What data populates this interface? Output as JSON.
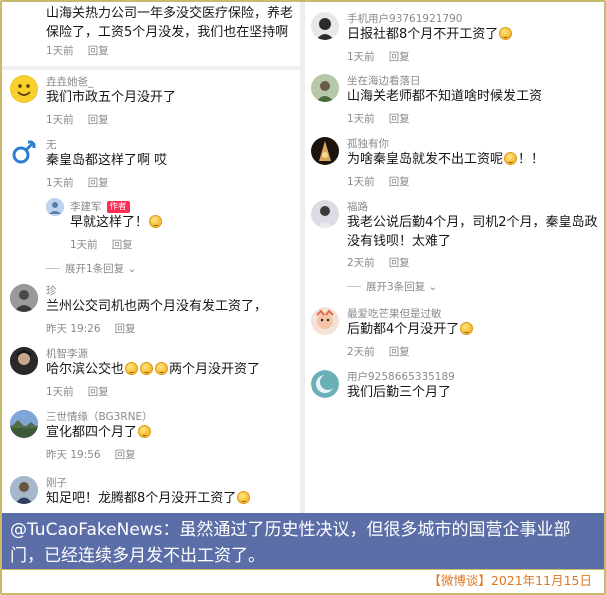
{
  "left_column": {
    "top_comment": {
      "text": "山海关热力公司一年多没交医疗保险，养老保险了，工资5个月没发，我们也在坚持啊",
      "time": "1天前",
      "reply": "回复"
    },
    "comments": [
      {
        "user": "垚垚她爸_",
        "text": "我们市政五个月没开了",
        "time": "1天前",
        "reply": "回复",
        "avatar": "smiley-face-icon",
        "avatar_color": "#f2c230"
      },
      {
        "user": "无",
        "text": "秦皇岛都这样了啊 哎",
        "time": "1天前",
        "reply": "回复",
        "avatar": "male-symbol-icon",
        "avatar_color": "#2a7fd4"
      },
      {
        "user": "珍",
        "text": "兰州公交司机也两个月没有发工资了，",
        "time": "昨天 19:26",
        "reply": "回复",
        "avatar": "person-photo-icon",
        "avatar_color": "#6b6b6b"
      },
      {
        "user": "机智李源",
        "text_before": "哈尔滨公交也",
        "text_after": "两个月没开资了",
        "time": "1天前",
        "reply": "回复",
        "avatar": "person-photo-icon",
        "avatar_color": "#303030"
      },
      {
        "user": "三世情缘（BG3RNE）",
        "text": "宣化都四个月了",
        "time": "昨天 19:56",
        "reply": "回复",
        "avatar": "landscape-photo-icon",
        "avatar_color": "#4a6a9a"
      },
      {
        "user": "刚子",
        "text": "知足吧！龙腾都8个月没开工资了",
        "time": "",
        "reply": "",
        "avatar": "person-photo-icon",
        "avatar_color": "#7a8aa0"
      }
    ],
    "sub_reply": {
      "user": "李建军",
      "author_tag": "作者",
      "text": "早就这样了！",
      "time": "1天前",
      "reply": "回复"
    },
    "expand_label": "展开1条回复"
  },
  "right_column": {
    "comments": [
      {
        "user": "手机用户93761921790",
        "text": "日报社都8个月不开工资了",
        "time": "1天前",
        "reply": "回复",
        "avatar_color": "#2b2b2b"
      },
      {
        "user": "坐在海边看落日",
        "text": "山海关老师都不知道啥时候发工资",
        "time": "1天前",
        "reply": "回复",
        "avatar_color": "#7a9a6a"
      },
      {
        "user": "孤独有你",
        "text": "为啥秦皇岛就发不出工资呢",
        "text_suffix": "！！",
        "time": "1天前",
        "reply": "回复",
        "avatar_color": "#3a2a18"
      },
      {
        "user": "福路",
        "text": "我老公说后勤4个月，司机2个月，秦皇岛政没有钱呗！太难了",
        "time": "2天前",
        "reply": "回复",
        "avatar_color": "#c8c8d0"
      },
      {
        "user": "最爱吃芒果但是过敏",
        "text": "后勤都4个月没开了",
        "time": "2天前",
        "reply": "回复",
        "avatar_color": "#d98a6a"
      },
      {
        "user": "用户9258665335189",
        "text": "我们后勤三个月了",
        "time": "",
        "reply": "",
        "avatar_color": "#6ab0b8"
      }
    ],
    "expand_label": "展开3条回复"
  },
  "caption": {
    "text": "@TuCaoFakeNews：虽然通过了历史性决议，但很多城市的国营企事业部门，已经连续多月发不出工资了。"
  },
  "footer": {
    "text": "【微博谈】2021年11月15日"
  },
  "colors": {
    "caption_bg": "#5c6ea8",
    "footer_text": "#e07820",
    "author_tag": "#fe2c55",
    "frame": "#c9b96a"
  }
}
